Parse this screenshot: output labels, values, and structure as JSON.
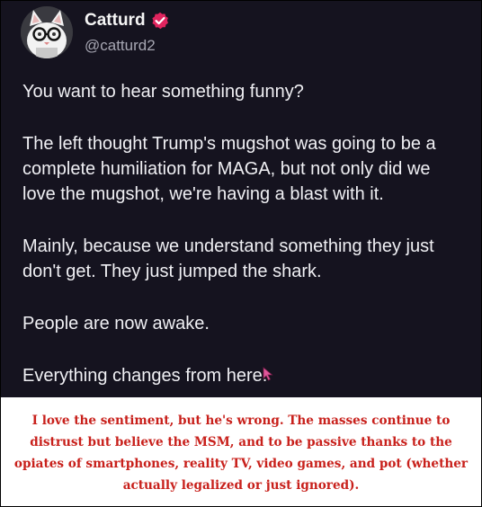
{
  "post": {
    "display_name": "Catturd",
    "handle": "@catturd2",
    "verified_badge_icon": "verified-badge-icon",
    "avatar_icon": "cat-with-glasses-avatar",
    "paragraphs": [
      "You want to hear something funny?",
      "The left thought Trump's mugshot was going to be a complete humiliation for MAGA, but not only did we love the mugshot, we're having a blast with it.",
      "Mainly, because we understand something they just don't get. They just jumped the shark.",
      "People are now awake.",
      "Everything changes from here."
    ]
  },
  "caption": {
    "text": "I love the sentiment, but he's wrong. The masses continue to distrust but believe the MSM, and to be passive thanks to the opiates of smartphones, reality TV, video games, and pot (whether actually legalized or just ignored)."
  },
  "colors": {
    "tweet_background": "#15131f",
    "tweet_text": "#f0f0f4",
    "handle_text": "#a7a7b3",
    "badge": "#e0245e",
    "caption_text": "#c8201b",
    "cursor": "#e0569a"
  }
}
